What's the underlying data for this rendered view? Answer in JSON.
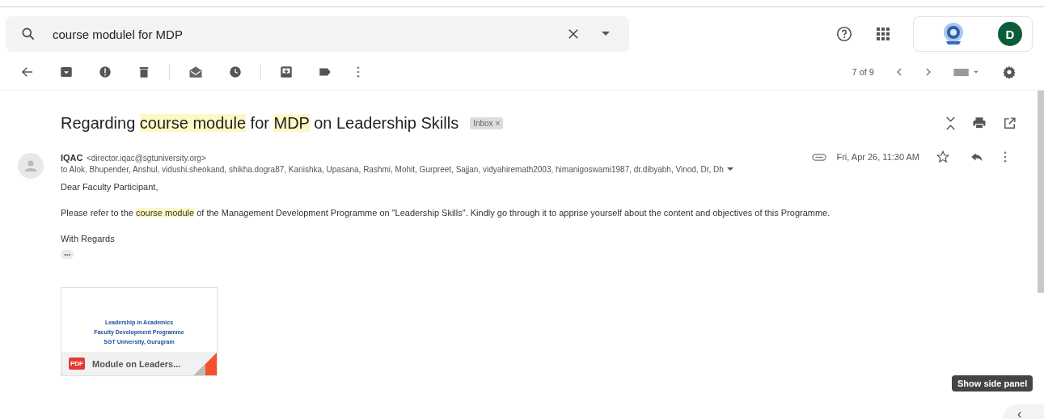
{
  "search": {
    "value": "course modulel for MDP"
  },
  "account": {
    "initial": "D"
  },
  "pager": {
    "position": "7 of 9"
  },
  "message": {
    "subject": [
      {
        "text": "Regarding ",
        "highlight": false
      },
      {
        "text": "course module",
        "highlight": true
      },
      {
        "text": " for ",
        "highlight": false
      },
      {
        "text": "MDP",
        "highlight": true
      },
      {
        "text": " on Leadership Skills",
        "highlight": false
      }
    ],
    "label": "Inbox",
    "label_close": "×",
    "sender_name": "IQAC",
    "sender_email": "<director.iqac@sgtuniversity.org>",
    "date": "Fri, Apr 26, 11:30 AM",
    "recipients": "to Alok, Bhupender, Anshul, vidushi.sheokand, shikha.dogra87, Kanishka, Upasana, Rashmi, Mohit, Gurpreet, Sajjan, vidyahiremath2003, himanigoswami1987, dr.dibyabh, Vinod, Dr, Dh",
    "greeting": "Dear Faculty Participant,",
    "paragraph": [
      {
        "text": "Please refer to the ",
        "highlight": false
      },
      {
        "text": "course module",
        "highlight": true
      },
      {
        "text": " of the Management Development Programme on \"Leadership Skills\". Kindly go through it to apprise yourself about the content and objectives of this Programme.",
        "highlight": false
      }
    ],
    "closing": "With Regards",
    "trimmed": "•••"
  },
  "attachment": {
    "preview_lines": [
      "Leadership in Academics",
      "Faculty Development Programme",
      "SGT University, Gurugram"
    ],
    "type_badge": "PDF",
    "name": "Module on Leaders..."
  },
  "tooltip": "Show side panel",
  "side_toggle": "‹"
}
